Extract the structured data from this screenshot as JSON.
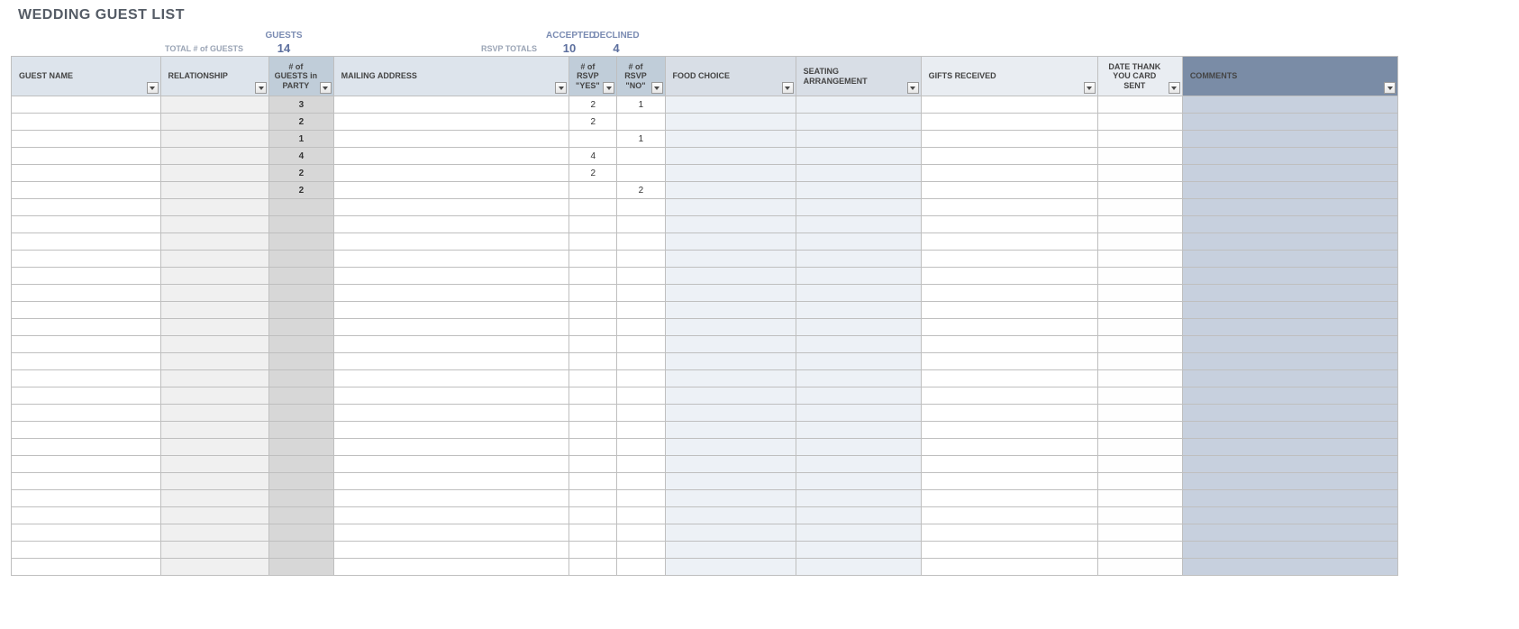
{
  "title": "WEDDING GUEST LIST",
  "summary": {
    "total_label": "TOTAL # of GUESTS",
    "guests_label": "GUESTS",
    "guests_value": "14",
    "rsvp_label": "RSVP TOTALS",
    "accepted_label": "ACCEPTED",
    "accepted_value": "10",
    "declined_label": "DECLINED",
    "declined_value": "4"
  },
  "columns": {
    "guest_name": "GUEST NAME",
    "relationship": "RELATIONSHIP",
    "party": "# of GUESTS in PARTY",
    "address": "MAILING ADDRESS",
    "rsvp_yes": "# of RSVP \"YES\"",
    "rsvp_no": "# of RSVP \"NO\"",
    "food": "FOOD CHOICE",
    "seating": "SEATING ARRANGEMENT",
    "gifts": "GIFTS RECEIVED",
    "thank": "DATE THANK YOU CARD SENT",
    "comments": "COMMENTS"
  },
  "rows": [
    {
      "guest_name": "",
      "relationship": "",
      "party": "3",
      "address": "",
      "rsvp_yes": "2",
      "rsvp_no": "1",
      "food": "",
      "seating": "",
      "gifts": "",
      "thank": "",
      "comments": ""
    },
    {
      "guest_name": "",
      "relationship": "",
      "party": "2",
      "address": "",
      "rsvp_yes": "2",
      "rsvp_no": "",
      "food": "",
      "seating": "",
      "gifts": "",
      "thank": "",
      "comments": ""
    },
    {
      "guest_name": "",
      "relationship": "",
      "party": "1",
      "address": "",
      "rsvp_yes": "",
      "rsvp_no": "1",
      "food": "",
      "seating": "",
      "gifts": "",
      "thank": "",
      "comments": ""
    },
    {
      "guest_name": "",
      "relationship": "",
      "party": "4",
      "address": "",
      "rsvp_yes": "4",
      "rsvp_no": "",
      "food": "",
      "seating": "",
      "gifts": "",
      "thank": "",
      "comments": ""
    },
    {
      "guest_name": "",
      "relationship": "",
      "party": "2",
      "address": "",
      "rsvp_yes": "2",
      "rsvp_no": "",
      "food": "",
      "seating": "",
      "gifts": "",
      "thank": "",
      "comments": ""
    },
    {
      "guest_name": "",
      "relationship": "",
      "party": "2",
      "address": "",
      "rsvp_yes": "",
      "rsvp_no": "2",
      "food": "",
      "seating": "",
      "gifts": "",
      "thank": "",
      "comments": ""
    },
    {
      "guest_name": "",
      "relationship": "",
      "party": "",
      "address": "",
      "rsvp_yes": "",
      "rsvp_no": "",
      "food": "",
      "seating": "",
      "gifts": "",
      "thank": "",
      "comments": ""
    },
    {
      "guest_name": "",
      "relationship": "",
      "party": "",
      "address": "",
      "rsvp_yes": "",
      "rsvp_no": "",
      "food": "",
      "seating": "",
      "gifts": "",
      "thank": "",
      "comments": ""
    },
    {
      "guest_name": "",
      "relationship": "",
      "party": "",
      "address": "",
      "rsvp_yes": "",
      "rsvp_no": "",
      "food": "",
      "seating": "",
      "gifts": "",
      "thank": "",
      "comments": ""
    },
    {
      "guest_name": "",
      "relationship": "",
      "party": "",
      "address": "",
      "rsvp_yes": "",
      "rsvp_no": "",
      "food": "",
      "seating": "",
      "gifts": "",
      "thank": "",
      "comments": ""
    },
    {
      "guest_name": "",
      "relationship": "",
      "party": "",
      "address": "",
      "rsvp_yes": "",
      "rsvp_no": "",
      "food": "",
      "seating": "",
      "gifts": "",
      "thank": "",
      "comments": ""
    },
    {
      "guest_name": "",
      "relationship": "",
      "party": "",
      "address": "",
      "rsvp_yes": "",
      "rsvp_no": "",
      "food": "",
      "seating": "",
      "gifts": "",
      "thank": "",
      "comments": ""
    },
    {
      "guest_name": "",
      "relationship": "",
      "party": "",
      "address": "",
      "rsvp_yes": "",
      "rsvp_no": "",
      "food": "",
      "seating": "",
      "gifts": "",
      "thank": "",
      "comments": ""
    },
    {
      "guest_name": "",
      "relationship": "",
      "party": "",
      "address": "",
      "rsvp_yes": "",
      "rsvp_no": "",
      "food": "",
      "seating": "",
      "gifts": "",
      "thank": "",
      "comments": ""
    },
    {
      "guest_name": "",
      "relationship": "",
      "party": "",
      "address": "",
      "rsvp_yes": "",
      "rsvp_no": "",
      "food": "",
      "seating": "",
      "gifts": "",
      "thank": "",
      "comments": ""
    },
    {
      "guest_name": "",
      "relationship": "",
      "party": "",
      "address": "",
      "rsvp_yes": "",
      "rsvp_no": "",
      "food": "",
      "seating": "",
      "gifts": "",
      "thank": "",
      "comments": ""
    },
    {
      "guest_name": "",
      "relationship": "",
      "party": "",
      "address": "",
      "rsvp_yes": "",
      "rsvp_no": "",
      "food": "",
      "seating": "",
      "gifts": "",
      "thank": "",
      "comments": ""
    },
    {
      "guest_name": "",
      "relationship": "",
      "party": "",
      "address": "",
      "rsvp_yes": "",
      "rsvp_no": "",
      "food": "",
      "seating": "",
      "gifts": "",
      "thank": "",
      "comments": ""
    },
    {
      "guest_name": "",
      "relationship": "",
      "party": "",
      "address": "",
      "rsvp_yes": "",
      "rsvp_no": "",
      "food": "",
      "seating": "",
      "gifts": "",
      "thank": "",
      "comments": ""
    },
    {
      "guest_name": "",
      "relationship": "",
      "party": "",
      "address": "",
      "rsvp_yes": "",
      "rsvp_no": "",
      "food": "",
      "seating": "",
      "gifts": "",
      "thank": "",
      "comments": ""
    },
    {
      "guest_name": "",
      "relationship": "",
      "party": "",
      "address": "",
      "rsvp_yes": "",
      "rsvp_no": "",
      "food": "",
      "seating": "",
      "gifts": "",
      "thank": "",
      "comments": ""
    },
    {
      "guest_name": "",
      "relationship": "",
      "party": "",
      "address": "",
      "rsvp_yes": "",
      "rsvp_no": "",
      "food": "",
      "seating": "",
      "gifts": "",
      "thank": "",
      "comments": ""
    },
    {
      "guest_name": "",
      "relationship": "",
      "party": "",
      "address": "",
      "rsvp_yes": "",
      "rsvp_no": "",
      "food": "",
      "seating": "",
      "gifts": "",
      "thank": "",
      "comments": ""
    },
    {
      "guest_name": "",
      "relationship": "",
      "party": "",
      "address": "",
      "rsvp_yes": "",
      "rsvp_no": "",
      "food": "",
      "seating": "",
      "gifts": "",
      "thank": "",
      "comments": ""
    },
    {
      "guest_name": "",
      "relationship": "",
      "party": "",
      "address": "",
      "rsvp_yes": "",
      "rsvp_no": "",
      "food": "",
      "seating": "",
      "gifts": "",
      "thank": "",
      "comments": ""
    },
    {
      "guest_name": "",
      "relationship": "",
      "party": "",
      "address": "",
      "rsvp_yes": "",
      "rsvp_no": "",
      "food": "",
      "seating": "",
      "gifts": "",
      "thank": "",
      "comments": ""
    },
    {
      "guest_name": "",
      "relationship": "",
      "party": "",
      "address": "",
      "rsvp_yes": "",
      "rsvp_no": "",
      "food": "",
      "seating": "",
      "gifts": "",
      "thank": "",
      "comments": ""
    },
    {
      "guest_name": "",
      "relationship": "",
      "party": "",
      "address": "",
      "rsvp_yes": "",
      "rsvp_no": "",
      "food": "",
      "seating": "",
      "gifts": "",
      "thank": "",
      "comments": ""
    }
  ]
}
